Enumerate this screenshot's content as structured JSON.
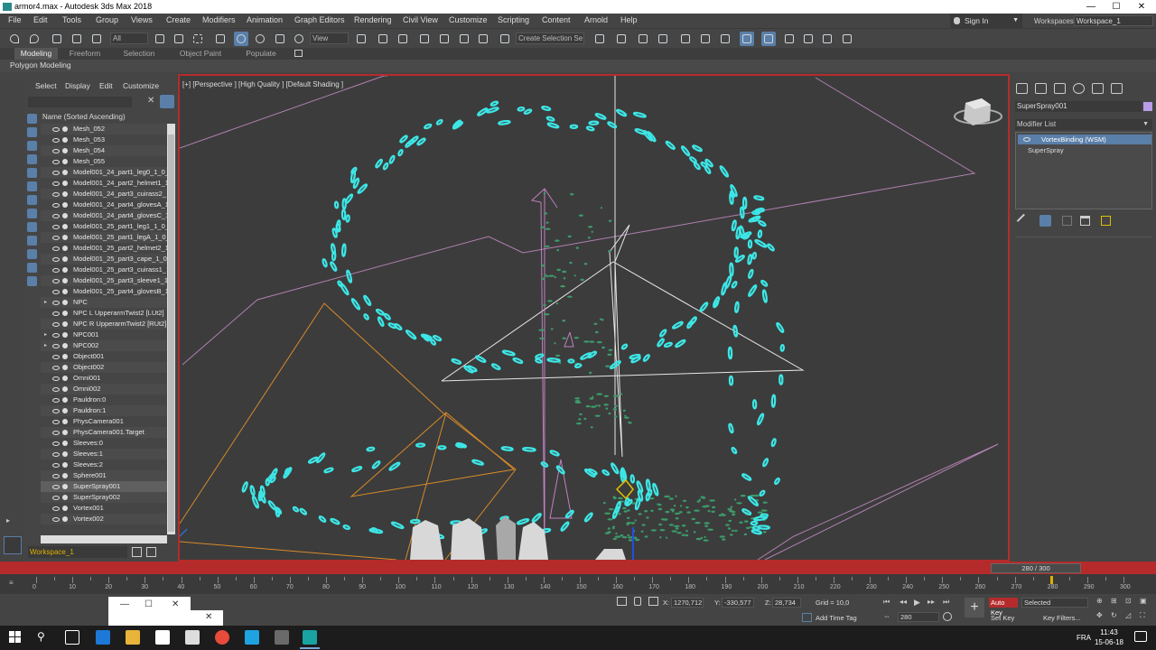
{
  "window": {
    "title": "armor4.max - Autodesk 3ds Max 2018",
    "min": "—",
    "max": "☐",
    "close": "✕"
  },
  "menu": [
    "File",
    "Edit",
    "Tools",
    "Group",
    "Views",
    "Create",
    "Modifiers",
    "Animation",
    "Graph Editors",
    "Rendering",
    "Civil View",
    "Customize",
    "Scripting",
    "Content",
    "Arnold",
    "Help"
  ],
  "account": {
    "sign_in": "Sign In",
    "workspaces_label": "Workspaces:",
    "workspace": "Workspace_1"
  },
  "toolbar": {
    "filter": "All",
    "coord_system": "View",
    "selection_set": "Create Selection Se"
  },
  "ribbon": {
    "tabs": [
      "Modeling",
      "Freeform",
      "Selection",
      "Object Paint",
      "Populate"
    ],
    "active": "Modeling",
    "panel": "Polygon Modeling"
  },
  "scene_explorer": {
    "menu": [
      "Select",
      "Display",
      "Edit",
      "Customize"
    ],
    "column_header": "Name (Sorted Ascending)",
    "items": [
      {
        "name": "Mesh_052",
        "exp": "",
        "sel": false
      },
      {
        "name": "Mesh_053",
        "exp": "",
        "sel": false
      },
      {
        "name": "Mesh_054",
        "exp": "",
        "sel": false
      },
      {
        "name": "Mesh_055",
        "exp": "",
        "sel": false
      },
      {
        "name": "Model001_24_part1_leg0_1_0_",
        "exp": "",
        "sel": false
      },
      {
        "name": "Model001_24_part2_helmet1_1",
        "exp": "",
        "sel": false
      },
      {
        "name": "Model001_24_part3_cuirass2_",
        "exp": "",
        "sel": false
      },
      {
        "name": "Model001_24_part4_glovesA_1",
        "exp": "",
        "sel": false
      },
      {
        "name": "Model001_24_part4_glovesC_1",
        "exp": "",
        "sel": false
      },
      {
        "name": "Model001_25_part1_leg1_1_0_",
        "exp": "",
        "sel": false
      },
      {
        "name": "Model001_25_part1_legA_1_0_",
        "exp": "",
        "sel": false
      },
      {
        "name": "Model001_25_part2_helmet2_1",
        "exp": "",
        "sel": false
      },
      {
        "name": "Model001_25_part3_cape_1_0_",
        "exp": "",
        "sel": false
      },
      {
        "name": "Model001_25_part3_cuirass1_1",
        "exp": "",
        "sel": false
      },
      {
        "name": "Model001_25_part3_sleeve1_1",
        "exp": "",
        "sel": false
      },
      {
        "name": "Model001_25_part4_glovesB_1",
        "exp": "",
        "sel": false
      },
      {
        "name": "NPC",
        "exp": "▸",
        "sel": false
      },
      {
        "name": "NPC L UpperarmTwist2 [LUt2]",
        "exp": "",
        "sel": false
      },
      {
        "name": "NPC R UpperarmTwist2 [RUt2]",
        "exp": "",
        "sel": false
      },
      {
        "name": "NPC001",
        "exp": "▸",
        "sel": false
      },
      {
        "name": "NPC002",
        "exp": "▸",
        "sel": false
      },
      {
        "name": "Object001",
        "exp": "",
        "sel": false
      },
      {
        "name": "Object002",
        "exp": "",
        "sel": false
      },
      {
        "name": "Omni001",
        "exp": "",
        "sel": false
      },
      {
        "name": "Omni002",
        "exp": "",
        "sel": false
      },
      {
        "name": "Pauldron:0",
        "exp": "",
        "sel": false
      },
      {
        "name": "Pauldron:1",
        "exp": "",
        "sel": false
      },
      {
        "name": "PhysCamera001",
        "exp": "",
        "sel": false
      },
      {
        "name": "PhysCamera001.Target",
        "exp": "",
        "sel": false
      },
      {
        "name": "Sleeves:0",
        "exp": "",
        "sel": false
      },
      {
        "name": "Sleeves:1",
        "exp": "",
        "sel": false
      },
      {
        "name": "Sleeves:2",
        "exp": "",
        "sel": false
      },
      {
        "name": "Sphere001",
        "exp": "",
        "sel": false
      },
      {
        "name": "SuperSpray001",
        "exp": "",
        "sel": true
      },
      {
        "name": "SuperSpray002",
        "exp": "",
        "sel": false
      },
      {
        "name": "Vortex001",
        "exp": "",
        "sel": false
      },
      {
        "name": "Vortex002",
        "exp": "",
        "sel": false
      }
    ],
    "footer_workspace": "Workspace_1"
  },
  "viewport": {
    "label": "[+] [Perspective ] [High Quality ] [Default Shading ]"
  },
  "command_panel": {
    "object_name": "SuperSpray001",
    "object_color": "#b99be8",
    "modifier_list": "Modifier List",
    "stack": [
      {
        "name": "VortexBinding (WSM)",
        "selected": true
      },
      {
        "name": "SuperSpray",
        "selected": false
      }
    ]
  },
  "timeline": {
    "slider": "280 / 300",
    "current_frame": 280,
    "labels": [
      "0",
      "10",
      "20",
      "30",
      "40",
      "50",
      "60",
      "70",
      "80",
      "90",
      "100",
      "110",
      "120",
      "130",
      "140",
      "150",
      "160",
      "170",
      "180",
      "190",
      "200",
      "210",
      "220",
      "230",
      "240",
      "250",
      "260",
      "270",
      "280",
      "290",
      "300"
    ]
  },
  "status": {
    "x_label": "X:",
    "x": "1270,712",
    "y_label": "Y:",
    "y": "-330,577",
    "z_label": "Z:",
    "z": "28,734",
    "grid": "Grid = 10,0",
    "add_time_tag": "Add Time Tag",
    "auto_key": "Auto Key",
    "set_key": "Set Key",
    "selected": "Selected",
    "key_filters": "Key Filters...",
    "frame": "280"
  },
  "taskbar": {
    "lang": "FRA",
    "time": "11:43",
    "date": "15-06-18"
  },
  "colors": {
    "accent": "#5a7fa8",
    "viewport_border": "#b52b2b",
    "particles": "#3de6e6",
    "autokey": "#b52b2b"
  }
}
